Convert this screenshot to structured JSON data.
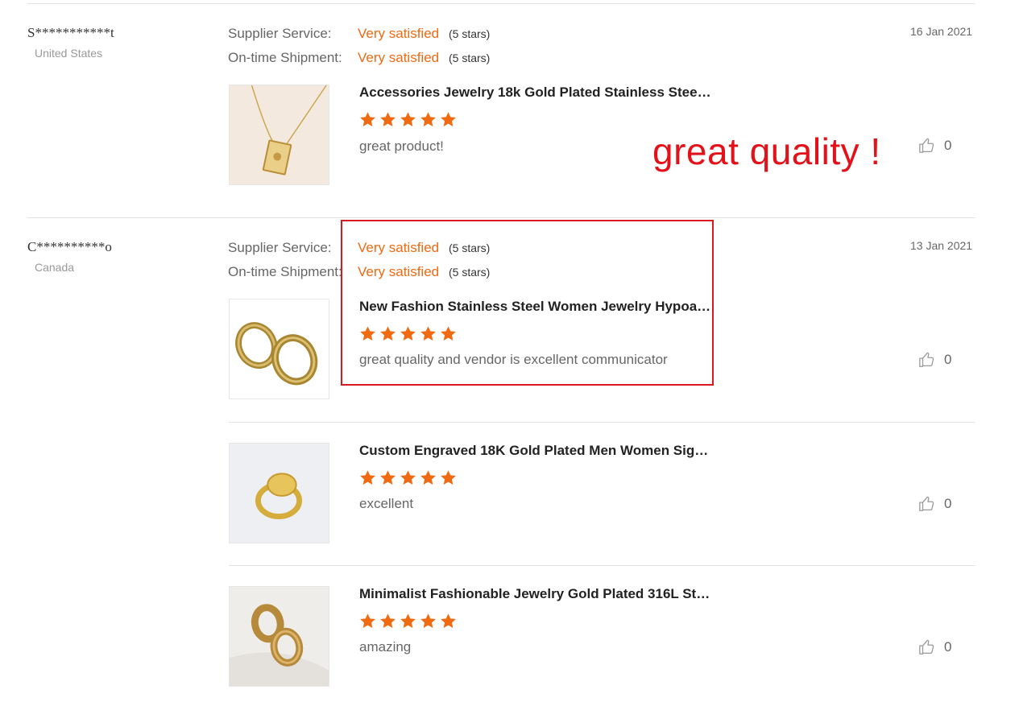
{
  "reviews": [
    {
      "buyer": "S***********t",
      "country": "United States",
      "date": "16 Jan 2021",
      "supplier_service_label": "Supplier Service:",
      "supplier_service_value": "Very satisfied",
      "supplier_service_stars": "(5 stars)",
      "shipment_label": "On-time Shipment:",
      "shipment_value": "Very satisfied",
      "shipment_stars": "(5 stars)",
      "products": [
        {
          "title": "Accessories Jewelry 18k Gold Plated Stainless Steel ...",
          "rating": 5,
          "comment": "great product!",
          "likes": "0",
          "image_icon": "necklace-image"
        }
      ]
    },
    {
      "buyer": "C**********o",
      "country": "Canada",
      "date": "13 Jan 2021",
      "supplier_service_label": "Supplier Service:",
      "supplier_service_value": "Very satisfied",
      "supplier_service_stars": "(5 stars)",
      "shipment_label": "On-time Shipment:",
      "shipment_value": "Very satisfied",
      "shipment_stars": "(5 stars)",
      "products": [
        {
          "title": "New Fashion Stainless Steel Women Jewelry Hypoall...",
          "rating": 5,
          "comment": "great quality and vendor is excellent communicator",
          "likes": "0",
          "image_icon": "hoop-earrings-image"
        },
        {
          "title": "Custom Engraved 18K Gold Plated Men Women Signe...",
          "rating": 5,
          "comment": "excellent",
          "likes": "0",
          "image_icon": "signet-ring-image"
        },
        {
          "title": "Minimalist Fashionable Jewelry Gold Plated 316L Stai...",
          "rating": 5,
          "comment": "amazing",
          "likes": "0",
          "image_icon": "chunky-hoop-image"
        }
      ]
    }
  ],
  "annotation": {
    "text": "great quality !",
    "color": "#e3121a"
  },
  "colors": {
    "accent": "#f06a12",
    "highlight_border": "#d71920",
    "divider": "#e3e3e3"
  },
  "icons": {
    "star": "star-icon",
    "like": "thumbs-up-icon"
  }
}
